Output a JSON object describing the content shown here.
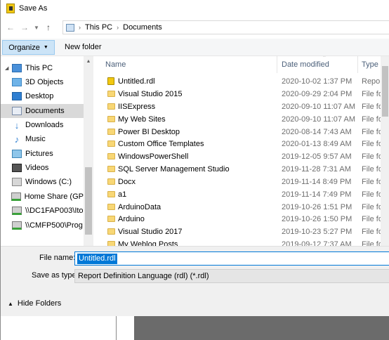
{
  "window": {
    "title": "Save As"
  },
  "address": {
    "segments": [
      "This PC",
      "Documents"
    ]
  },
  "toolbar": {
    "organize_label": "Organize",
    "new_folder_label": "New folder"
  },
  "nav": {
    "items": [
      {
        "label": "This PC",
        "icon": "pc-icon"
      },
      {
        "label": "3D Objects",
        "icon": "3d-objects-icon"
      },
      {
        "label": "Desktop",
        "icon": "desktop-icon"
      },
      {
        "label": "Documents",
        "icon": "documents-icon"
      },
      {
        "label": "Downloads",
        "icon": "downloads-icon"
      },
      {
        "label": "Music",
        "icon": "music-icon"
      },
      {
        "label": "Pictures",
        "icon": "pictures-icon"
      },
      {
        "label": "Videos",
        "icon": "videos-icon"
      },
      {
        "label": "Windows (C:)",
        "icon": "drive-icon"
      },
      {
        "label": "Home Share (GP",
        "icon": "network-drive-icon"
      },
      {
        "label": "\\\\DC1FAP003\\Ito",
        "icon": "network-drive-icon"
      },
      {
        "label": "\\\\CMFP500\\Prog",
        "icon": "network-drive-icon"
      }
    ]
  },
  "list": {
    "columns": [
      "Name",
      "Date modified",
      "Type"
    ],
    "rows": [
      {
        "name": "Untitled.rdl",
        "date": "2020-10-02 1:37 PM",
        "type": "Report B"
      },
      {
        "name": "Visual Studio 2015",
        "date": "2020-09-29 2:04 PM",
        "type": "File folde"
      },
      {
        "name": "IISExpress",
        "date": "2020-09-10 11:07 AM",
        "type": "File folde"
      },
      {
        "name": "My Web Sites",
        "date": "2020-09-10 11:07 AM",
        "type": "File folde"
      },
      {
        "name": "Power BI Desktop",
        "date": "2020-08-14 7:43 AM",
        "type": "File folde"
      },
      {
        "name": "Custom Office Templates",
        "date": "2020-01-13 8:49 AM",
        "type": "File folde"
      },
      {
        "name": "WindowsPowerShell",
        "date": "2019-12-05 9:57 AM",
        "type": "File folde"
      },
      {
        "name": "SQL Server Management Studio",
        "date": "2019-11-28 7:31 AM",
        "type": "File folde"
      },
      {
        "name": "Docx",
        "date": "2019-11-14 8:49 PM",
        "type": "File folde"
      },
      {
        "name": "a1",
        "date": "2019-11-14 7:49 PM",
        "type": "File folde"
      },
      {
        "name": "ArduinoData",
        "date": "2019-10-26 1:51 PM",
        "type": "File folde"
      },
      {
        "name": "Arduino",
        "date": "2019-10-26 1:50 PM",
        "type": "File folde"
      },
      {
        "name": "Visual Studio 2017",
        "date": "2019-10-23 5:27 PM",
        "type": "File folde"
      },
      {
        "name": "My Weblog Posts",
        "date": "2019-09-12 7:37 AM",
        "type": "File folde"
      }
    ]
  },
  "form": {
    "file_name_label": "File name:",
    "file_name_value": "Untitled.rdl",
    "save_as_type_label": "Save as type:",
    "save_as_type_value": "Report Definition Language (rdl)  (*.rdl)"
  },
  "footer": {
    "hide_folders_label": "Hide Folders"
  },
  "colors": {
    "accent": "#0078d7",
    "organize_bg": "#cce4f7",
    "selected_nav": "#d9d9d9"
  }
}
